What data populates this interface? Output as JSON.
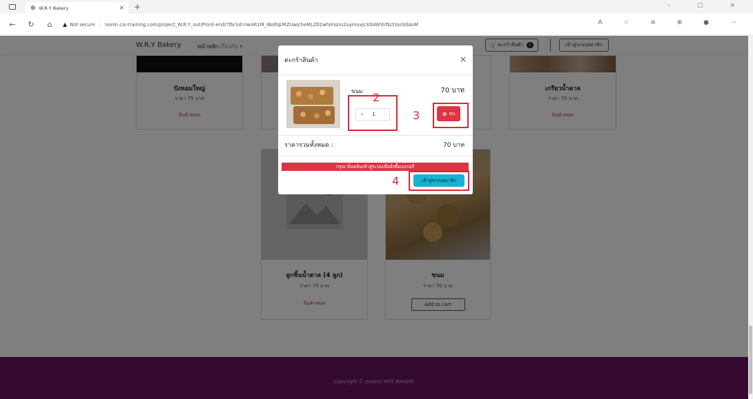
{
  "browser": {
    "tab_title": "W.R.Y Bakery",
    "not_secure": "Not secure",
    "url": "nonin.cis-training.com/project_W.R.Y_out/Front-end/?fbclid=IwAR1M_I8oIfqURZUwjchеMLZ02wfzmsno2uymuvjcX0AWYoTsLYzsoS0AoM"
  },
  "nav": {
    "brand": "W.R.Y Bakery",
    "home": "หน้าหลัก",
    "about": "เกี่ยวกับ ▾",
    "cart_label": "ตะกร้าสินค้า",
    "cart_count": "1",
    "login": "เข้าสู่ระบบสมาชิก"
  },
  "products": [
    {
      "name": "ปังหอมใหญ่",
      "price": "ราคา 75 บาท",
      "status": "สินค้าหมด"
    },
    {
      "name": "เกรียวน้ำตาล",
      "price": "ราคา 75 บาท",
      "status": "สินค้าหมด"
    },
    {
      "name": "ลูกชิ้นน้ำตาล (4 ลูก)",
      "price": "ราคา 75 บาท",
      "status": "สินค้าหมด"
    },
    {
      "name": "ขนม",
      "price": "ราคา 70 บาท",
      "button": "Add to cart"
    }
  ],
  "footer": {
    "copyright": "Copyright © project WRY BAKERY"
  },
  "modal": {
    "title": "ตะกร้าสินค้า",
    "close": "×",
    "item_name": "ขนม",
    "item_price": "70 บาท",
    "qty": "1",
    "minus": "-",
    "plus": "+",
    "delete": "ลบ",
    "total_label": "ราคารวมทั้งหมด :",
    "total_value": "70 บาท",
    "alert": "กรุณาล็อคอินเข้าสู่ระบบเพื่อสั่งซื้อเบเกอรี่",
    "login_button": "เข้าสู่ระบบสมาชิก"
  },
  "annotations": [
    "2",
    "3",
    "4"
  ],
  "colors": {
    "footer": "#6a1461",
    "danger": "#dc3545",
    "info": "#17b2d6",
    "highlight": "#e0242e"
  }
}
